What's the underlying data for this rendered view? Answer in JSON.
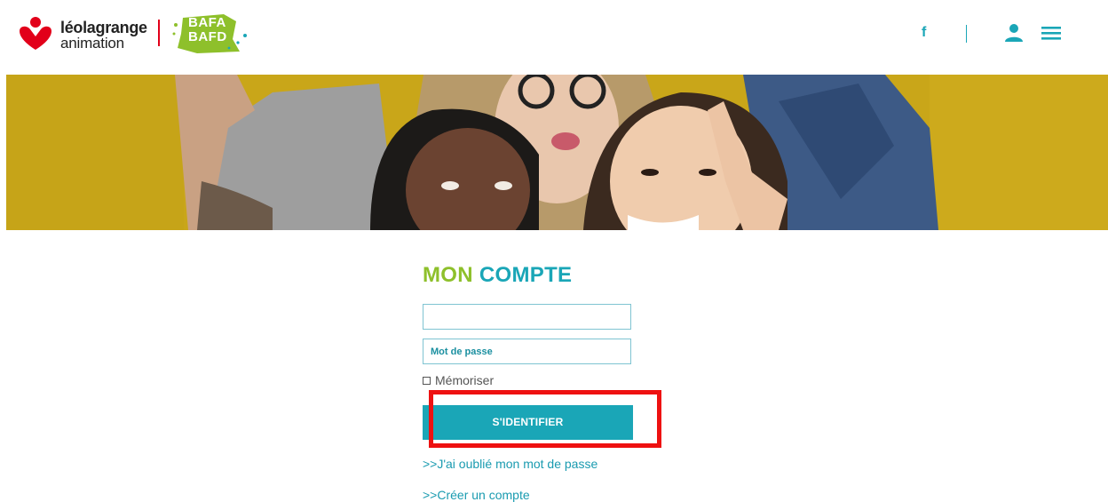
{
  "header": {
    "brand_line1": "léolagrange",
    "brand_line2": "animation",
    "badge_line1": "BAFA",
    "badge_line2": "BAFD",
    "facebook_label": "f",
    "icons": [
      "logo-heart-icon",
      "facebook-icon",
      "user-icon",
      "hamburger-menu-icon"
    ]
  },
  "login": {
    "title_part1": "MON",
    "title_part2": "COMPTE",
    "username_value": "",
    "password_placeholder": "Mot de passe",
    "remember_label": "Mémoriser",
    "submit_label": "S'IDENTIFIER",
    "forgot_link": ">>J'ai oublié mon mot de passe",
    "create_link": ">>Créer un compte"
  },
  "colors": {
    "accent_teal": "#1aa6b7",
    "accent_green": "#8ec02b",
    "brand_red": "#e2001a",
    "hero_yellow": "#c9a619",
    "highlight_red": "#ee1111"
  }
}
